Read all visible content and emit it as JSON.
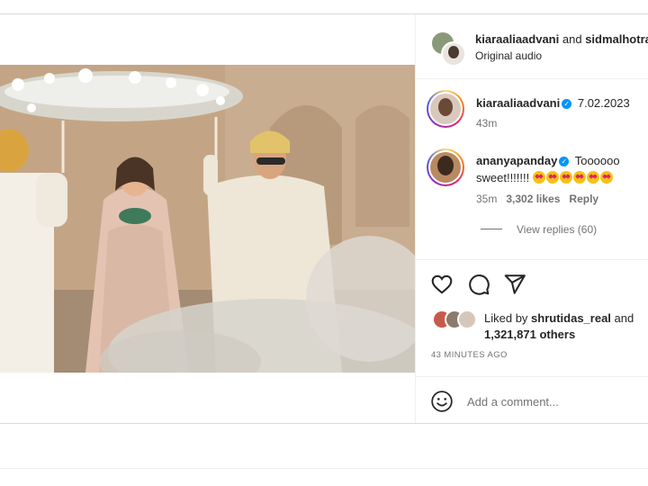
{
  "header": {
    "user1": "kiaraaliaadvani",
    "joiner": "and",
    "user2": "sidmalhotra",
    "audio": "Original audio"
  },
  "caption": {
    "username": "kiaraaliaadvani",
    "text": "7.02.2023",
    "time": "43m"
  },
  "comment": {
    "username": "ananyapanday",
    "text": "Toooooo sweet!!!!!!!",
    "time": "35m",
    "likes": "3,302 likes",
    "reply": "Reply",
    "view_replies": "View replies (60)"
  },
  "likes": {
    "prefix": "Liked by",
    "user": "shrutidas_real",
    "and": "and",
    "others": "1,321,871 others"
  },
  "timestamp": "43 MINUTES AGO",
  "comment_box": {
    "placeholder": "Add a comment..."
  },
  "icons": {
    "like": "heart-icon",
    "comment": "comment-icon",
    "share": "send-icon",
    "mute": "muted-speaker-icon",
    "emoji": "smiley-icon",
    "verified": "verified-badge-icon"
  },
  "colors": {
    "verified": "#0095f6",
    "muted_text": "#737373",
    "text": "#262626"
  }
}
